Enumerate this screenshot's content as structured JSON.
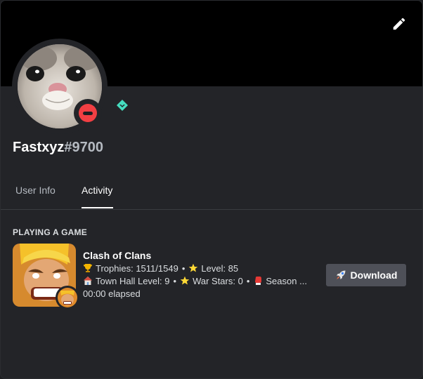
{
  "profile": {
    "username": "Fastxyz",
    "discriminator": "#9700",
    "status": "do-not-disturb",
    "badge_icon": "hypesquad-balance-icon",
    "banner_color": "#000000",
    "status_color": "#f23f43",
    "badge_color": "#45ddc0"
  },
  "tabs": [
    {
      "label": "User Info"
    },
    {
      "label": "Activity"
    }
  ],
  "activity": {
    "section_title": "PLAYING A GAME",
    "game": {
      "title": "Clash of Clans",
      "trophies": "Trophies: 1511/1549",
      "level": "Level: 85",
      "town_hall": "Town Hall Level: 9",
      "war_stars": "War Stars: 0",
      "season": "Season ...",
      "elapsed": "00:00 elapsed"
    },
    "download_label": "Download"
  },
  "icons": {
    "edit": "pencil-icon",
    "trophy": "trophy-icon",
    "star": "star-icon",
    "house": "house-icon",
    "glove": "boxing-glove-icon",
    "rocket": "rocket-icon"
  }
}
